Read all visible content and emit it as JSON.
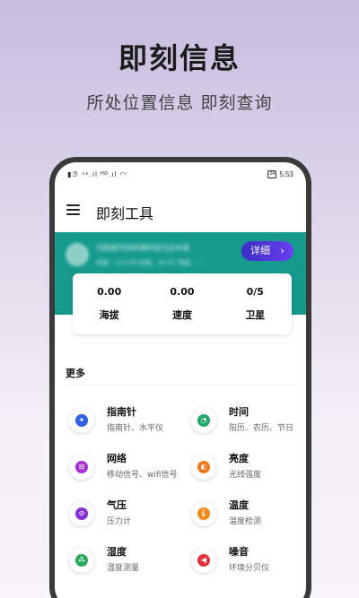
{
  "promo": {
    "title": "即刻信息",
    "subtitle": "所处位置信息 即刻查询"
  },
  "statusbar": {
    "left": "▮ℬ ⁴⁶.ıl ᴴᴰ.ıl ◠",
    "battery": "34",
    "time": "5:53"
  },
  "appbar": {
    "title": "即刻工具"
  },
  "banner": {
    "location_line1": "河南省开封市通许县冯庄乡道",
    "location_line2": "经度：114.56 纬度：34.47 海拔：—",
    "detail_label": "详细",
    "detail_chevron": "›"
  },
  "stats": [
    {
      "value": "0.00",
      "label": "海拔"
    },
    {
      "value": "0.00",
      "label": "速度"
    },
    {
      "value": "0/5",
      "label": "卫星"
    }
  ],
  "more": {
    "title": "更多"
  },
  "tools": [
    {
      "name": "指南针",
      "desc": "指南针、水平仪",
      "icon": "compass-icon",
      "color": "#2f5fe0",
      "glyph": "✦"
    },
    {
      "name": "时间",
      "desc": "阳历、农历、节日",
      "icon": "clock-icon",
      "color": "#21a86a",
      "glyph": "◔"
    },
    {
      "name": "网络",
      "desc": "移动信号、wifi信号",
      "icon": "network-icon",
      "color": "#a52fd0",
      "glyph": "⊞"
    },
    {
      "name": "亮度",
      "desc": "光线强度",
      "icon": "brightness-icon",
      "color": "#f07a1a",
      "glyph": "◐"
    },
    {
      "name": "气压",
      "desc": "压力计",
      "icon": "pressure-icon",
      "color": "#8a2fd6",
      "glyph": "⊘"
    },
    {
      "name": "温度",
      "desc": "温度检测",
      "icon": "thermometer-icon",
      "color": "#f08a1a",
      "glyph": "🌡"
    },
    {
      "name": "湿度",
      "desc": "湿度测量",
      "icon": "humidity-icon",
      "color": "#2aa85a",
      "glyph": "⁂"
    },
    {
      "name": "噪音",
      "desc": "环境分贝仪",
      "icon": "noise-icon",
      "color": "#e0343a",
      "glyph": "◀"
    }
  ]
}
